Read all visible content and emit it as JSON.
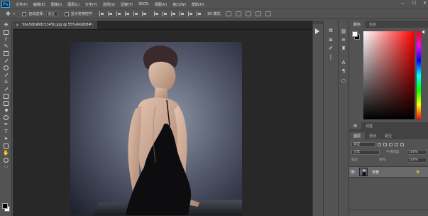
{
  "app": {
    "logo": "Ps"
  },
  "menu": [
    "文件(F)",
    "编辑(E)",
    "图像(I)",
    "图层(L)",
    "文字(Y)",
    "选择(S)",
    "滤镜(T)",
    "3D(D)",
    "视图(V)",
    "窗口(W)",
    "帮助(H)"
  ],
  "window_controls": {
    "minimize": "—",
    "maximize": "☐",
    "close": "✕"
  },
  "options_bar": {
    "auto_select_label": "自动选择:",
    "auto_select_value": "图层",
    "show_transform_label": "显示变换控件",
    "mode_3d_label": "3D 模式:"
  },
  "document": {
    "tab_title": "56a5db968c5345b.jpg @ 55%(RGB/8#)",
    "close_glyph": "×"
  },
  "panels": {
    "color_tabs": [
      "颜色",
      "色板"
    ],
    "mid_tabs": [
      "库",
      "调整"
    ],
    "layer_tabs": [
      "图层",
      "通道",
      "路径"
    ],
    "kind_value": "类型",
    "blend_value": "正常",
    "opacity_label": "不透明度:",
    "opacity_value": "100%",
    "lock_label": "锁定:",
    "fill_label": "填充:",
    "fill_value": "100%",
    "layer_name": "背景",
    "eye_glyph": "👁",
    "lock_glyph": "🔒"
  },
  "colors": {
    "foreground": "#000000",
    "background": "#ffffff",
    "color_picker_hue": "#ff0000",
    "ui_dark": "#535353"
  }
}
